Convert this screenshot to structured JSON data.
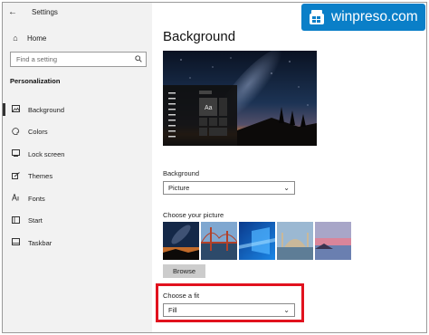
{
  "window": {
    "back_glyph": "←",
    "title": "Settings"
  },
  "sidebar": {
    "home_label": "Home",
    "search_placeholder": "Find a setting",
    "section_title": "Personalization",
    "items": [
      {
        "label": "Background",
        "icon": "picture-icon",
        "active": true
      },
      {
        "label": "Colors",
        "icon": "palette-icon",
        "active": false
      },
      {
        "label": "Lock screen",
        "icon": "lock-screen-icon",
        "active": false
      },
      {
        "label": "Themes",
        "icon": "brush-icon",
        "active": false
      },
      {
        "label": "Fonts",
        "icon": "font-icon",
        "active": false
      },
      {
        "label": "Start",
        "icon": "start-icon",
        "active": false
      },
      {
        "label": "Taskbar",
        "icon": "taskbar-icon",
        "active": false
      }
    ]
  },
  "main": {
    "page_title": "Background",
    "preview_sample_text": "Aa",
    "background_label": "Background",
    "background_value": "Picture",
    "choose_picture_label": "Choose your picture",
    "browse_label": "Browse",
    "fit_label": "Choose a fit",
    "fit_value": "Fill"
  },
  "brand": {
    "text": "winpreso.com",
    "logo_icon": "winpreso-logo",
    "color": "#0a7fc8"
  },
  "colors": {
    "highlight": "#e1121e",
    "sidebar_bg": "#f2f2f2"
  }
}
